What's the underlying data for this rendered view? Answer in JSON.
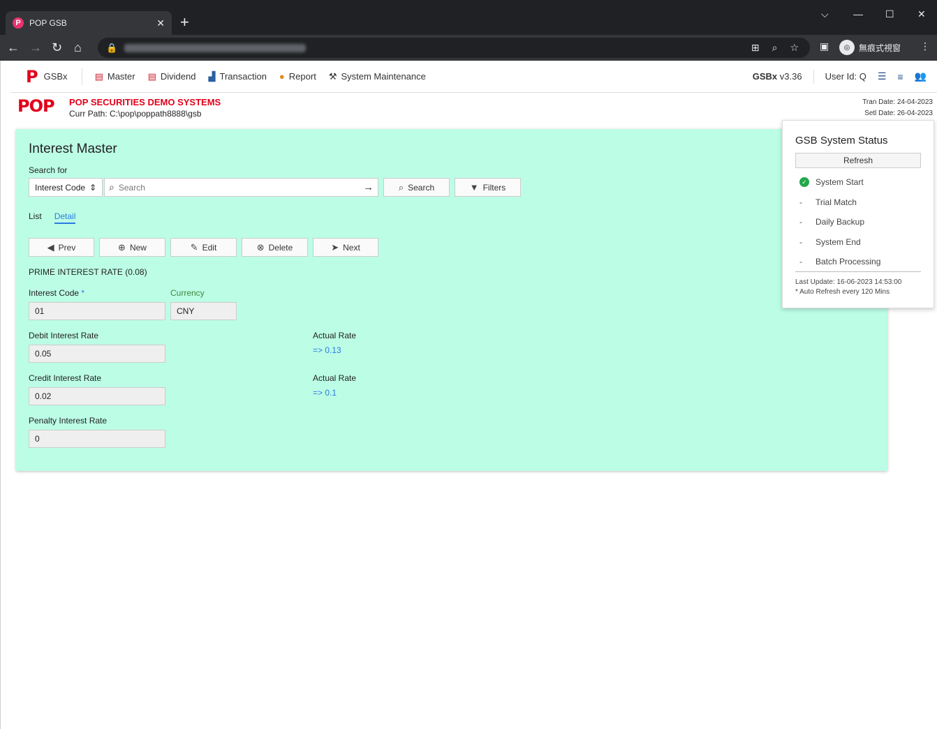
{
  "browser": {
    "tab_title": "POP GSB",
    "tab_favicon": "P",
    "incognito_label": "無痕式視窗"
  },
  "menubar": {
    "brand": "GSBx",
    "items": [
      {
        "label": "Master",
        "icon": "master-icon"
      },
      {
        "label": "Dividend",
        "icon": "dividend-icon"
      },
      {
        "label": "Transaction",
        "icon": "transaction-icon"
      },
      {
        "label": "Report",
        "icon": "report-icon"
      },
      {
        "label": "System Maintenance",
        "icon": "hammer-icon"
      }
    ],
    "version_name": "GSBx",
    "version_num": "v3.36",
    "user_id": "User Id: Q"
  },
  "header": {
    "company": "POP SECURITIES DEMO SYSTEMS",
    "curr_path": "Curr Path: C:\\pop\\poppath8888\\gsb",
    "tran_date": "Tran Date: 24-04-2023",
    "setl_date": "Setl Date: 26-04-2023"
  },
  "main": {
    "title": "Interest Master",
    "search_for": "Search for",
    "search_field": "Interest Code",
    "search_placeholder": "Search",
    "search_button": "Search",
    "filters_button": "Filters",
    "tabs": [
      {
        "label": "List"
      },
      {
        "label": "Detail"
      }
    ],
    "buttons": {
      "prev": "Prev",
      "new": "New",
      "edit": "Edit",
      "delete": "Delete",
      "next": "Next"
    },
    "record_title": "PRIME INTEREST RATE (0.08)",
    "fields": {
      "interest_code_label": "Interest Code",
      "interest_code_req": "*",
      "interest_code": "01",
      "currency_label": "Currency",
      "currency": "CNY",
      "debit_label": "Debit Interest Rate",
      "debit": "0.05",
      "debit_actual_label": "Actual Rate",
      "debit_actual": "=> 0.13",
      "credit_label": "Credit Interest Rate",
      "credit": "0.02",
      "credit_actual_label": "Actual Rate",
      "credit_actual": "=> 0.1",
      "penalty_label": "Penalty Interest Rate",
      "penalty": "0"
    }
  },
  "status": {
    "title": "GSB System Status",
    "refresh": "Refresh",
    "items": [
      {
        "label": "System Start",
        "state": "done"
      },
      {
        "label": "Trial Match",
        "state": "pending"
      },
      {
        "label": "Daily Backup",
        "state": "pending"
      },
      {
        "label": "System End",
        "state": "pending"
      },
      {
        "label": "Batch Processing",
        "state": "pending"
      }
    ],
    "last_update": "Last Update: 16-06-2023 14:53:00",
    "auto_refresh": "* Auto Refresh every 120 Mins"
  },
  "colors": {
    "panel_bg": "#bcfde6",
    "brand_red": "#e2001a",
    "link_blue": "#2a7ae2"
  }
}
